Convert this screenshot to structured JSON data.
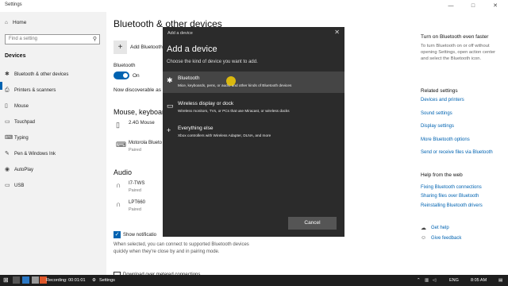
{
  "window": {
    "title": "Settings",
    "minimize": "—",
    "maximize": "□",
    "close": "✕"
  },
  "sidebar": {
    "home_icon": "home-icon",
    "home_label": "Home",
    "search_placeholder": "Find a setting",
    "section_title": "Devices",
    "items": [
      {
        "label": "Bluetooth & other devices",
        "icon": "bluetooth-icon"
      },
      {
        "label": "Printers & scanners",
        "icon": "printer-icon"
      },
      {
        "label": "Mouse",
        "icon": "mouse-icon"
      },
      {
        "label": "Touchpad",
        "icon": "touchpad-icon"
      },
      {
        "label": "Typing",
        "icon": "keyboard-icon"
      },
      {
        "label": "Pen & Windows Ink",
        "icon": "pen-icon"
      },
      {
        "label": "AutoPlay",
        "icon": "autoplay-icon"
      },
      {
        "label": "USB",
        "icon": "usb-icon"
      }
    ]
  },
  "main": {
    "title": "Bluetooth & other devices",
    "add_label": "Add Bluetooth",
    "bluetooth_label": "Bluetooth",
    "toggle_state": "On",
    "discoverable": "Now discoverable as \"",
    "mouse_section": "Mouse, keyboard",
    "devices": [
      {
        "name": "2.4G Mouse",
        "status": ""
      },
      {
        "name": "Motorola Blueto",
        "status": "Paired"
      }
    ],
    "audio_section": "Audio",
    "audio_devices": [
      {
        "name": "I7-TWS",
        "status": "Paired"
      },
      {
        "name": "LPT660",
        "status": "Paired"
      }
    ],
    "show_notifications": "Show notificatio",
    "notification_desc_1": "When selected, you can connect to supported Bluetooth devices",
    "notification_desc_2": "quickly when they're close by and in pairing mode.",
    "metered_label": "Download over metered connections"
  },
  "right": {
    "turn_on_title": "Turn on Bluetooth even faster",
    "turn_on_desc": "To turn Bluetooth on or off without opening Settings, open action center and select the Bluetooth icon.",
    "related_title": "Related settings",
    "related_links": [
      "Devices and printers",
      "Sound settings",
      "Display settings",
      "More Bluetooth options",
      "Send or receive files via Bluetooth"
    ],
    "help_title": "Help from the web",
    "help_links": [
      "Fixing Bluetooth connections",
      "Sharing files over Bluetooth",
      "Reinstalling Bluetooth drivers"
    ],
    "get_help": "Get help",
    "give_feedback": "Give feedback"
  },
  "dialog": {
    "title_bar": "Add a device",
    "close": "✕",
    "heading": "Add a device",
    "subtitle": "Choose the kind of device you want to add.",
    "options": [
      {
        "name": "Bluetooth",
        "desc": "Mice, keyboards, pens, or audio and other kinds of Bluetooth devices",
        "icon": "bluetooth-icon"
      },
      {
        "name": "Wireless display or dock",
        "desc": "Wireless monitors, TVs, or PCs that use Miracast, or wireless docks",
        "icon": "monitor-icon"
      },
      {
        "name": "Everything else",
        "desc": "Xbox controllers with Wireless Adapter, DLNA, and more",
        "icon": "plus-icon"
      }
    ],
    "cancel": "Cancel"
  },
  "taskbar": {
    "recording": "Recording: 00:01:01",
    "settings": "Settings",
    "lang": "ENG",
    "time": "8:05 AM"
  },
  "colors": {
    "accent": "#0063b1",
    "dialog_bg": "#2b2b2b",
    "cursor_highlight": "#ffd500"
  }
}
